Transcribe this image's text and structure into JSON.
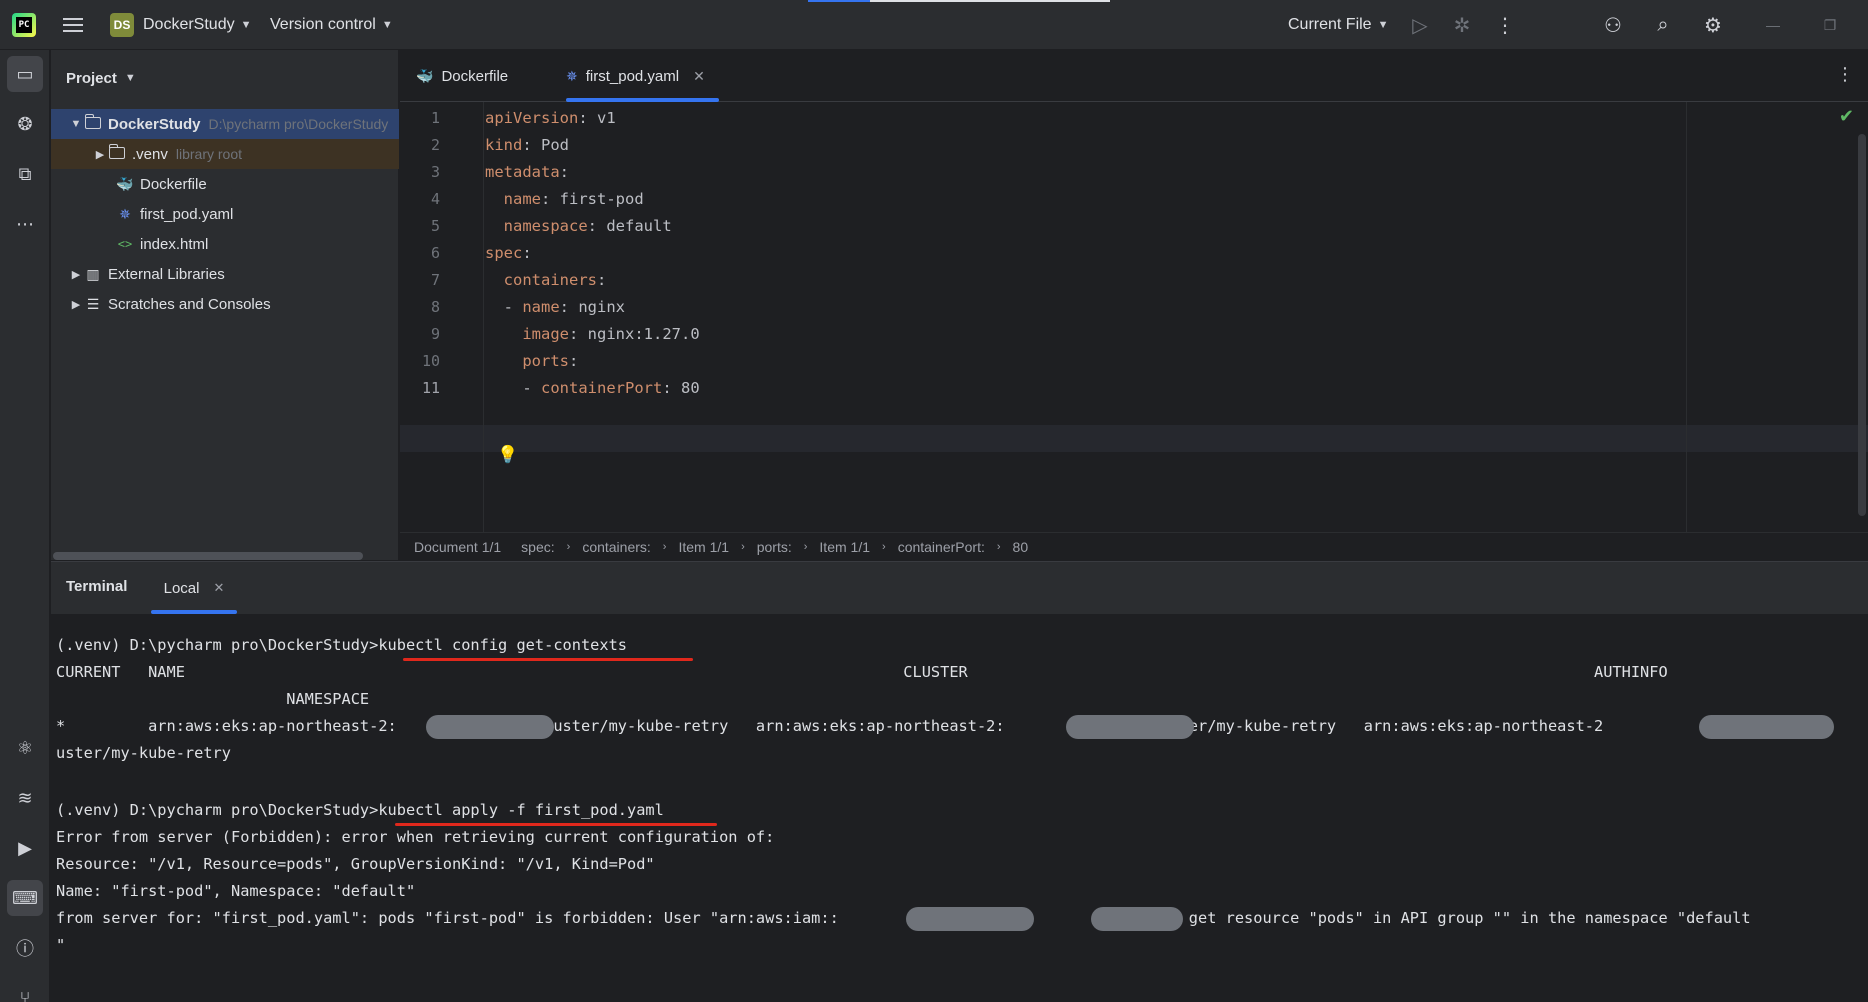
{
  "topbar": {
    "project_badge": "DS",
    "project_name": "DockerStudy",
    "vcs_label": "Version control",
    "run_config": "Current File"
  },
  "project_panel": {
    "title": "Project",
    "items": [
      {
        "label": "DockerStudy",
        "hint": "D:\\pycharm pro\\DockerStudy"
      },
      {
        "label": ".venv",
        "hint": "library root"
      },
      {
        "label": "Dockerfile"
      },
      {
        "label": "first_pod.yaml"
      },
      {
        "label": "index.html"
      },
      {
        "label": "External Libraries"
      },
      {
        "label": "Scratches and Consoles"
      }
    ]
  },
  "editor": {
    "tabs": [
      {
        "label": "Dockerfile"
      },
      {
        "label": "first_pod.yaml"
      }
    ],
    "lines": [
      {
        "num": "1",
        "text": "apiVersion: v1"
      },
      {
        "num": "2",
        "text": "kind: Pod"
      },
      {
        "num": "3",
        "text": "metadata:"
      },
      {
        "num": "4",
        "text": "  name: first-pod"
      },
      {
        "num": "5",
        "text": "  namespace: default"
      },
      {
        "num": "6",
        "text": "spec:"
      },
      {
        "num": "7",
        "text": "  containers:"
      },
      {
        "num": "8",
        "text": "  - name: nginx"
      },
      {
        "num": "9",
        "text": "    image: nginx:1.27.0"
      },
      {
        "num": "10",
        "text": "    ports:"
      },
      {
        "num": "11",
        "text": "    - containerPort: 80"
      }
    ],
    "breadcrumbs": [
      "Document 1/1",
      "spec:",
      "containers:",
      "Item 1/1",
      "ports:",
      "Item 1/1",
      "containerPort:",
      "80"
    ]
  },
  "terminal": {
    "title": "Terminal",
    "tab": "Local",
    "lines": [
      "(.venv) D:\\pycharm pro\\DockerStudy>kubectl config get-contexts",
      "CURRENT   NAME                                                                              CLUSTER                                                                    AUTHINFO",
      "                         NAMESPACE",
      "*         arn:aws:eks:ap-northeast-2:              :cluster/my-kube-retry   arn:aws:eks:ap-northeast-2:              :cluster/my-kube-retry   arn:aws:eks:ap-northeast-2               cl",
      "uster/my-kube-retry",
      "",
      "(.venv) D:\\pycharm pro\\DockerStudy>kubectl apply -f first_pod.yaml",
      "Error from server (Forbidden): error when retrieving current configuration of:",
      "Resource: \"/v1, Resource=pods\", GroupVersionKind: \"/v1, Kind=Pod\"",
      "Name: \"first-pod\", Namespace: \"default\"",
      "from server for: \"first_pod.yaml\": pods \"first-pod\" is forbidden: User \"arn:aws:iam::              :user/         \" cannot get resource \"pods\" in API group \"\" in the namespace \"default",
      "\""
    ]
  }
}
